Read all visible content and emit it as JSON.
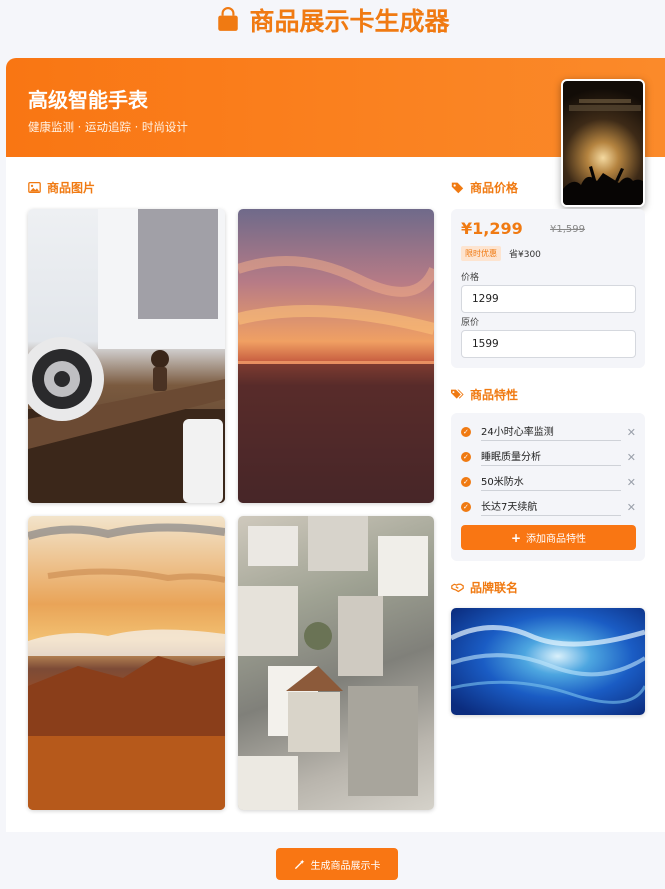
{
  "header": {
    "title": "商品展示卡生成器",
    "icon": "shopping-bag-icon"
  },
  "banner": {
    "title": "高级智能手表",
    "subtitle": "健康监测 · 运动追踪 · 时尚设计"
  },
  "images_section": {
    "heading": "商品图片",
    "icon": "image-icon"
  },
  "price_section": {
    "heading": "商品价格",
    "icon": "tag-icon",
    "current": "¥1,299",
    "original": "¥1,599",
    "promo_badge": "限时优惠",
    "save_text": "省¥300",
    "price_label": "价格",
    "price_value": "1299",
    "original_label": "原价",
    "original_value": "1599"
  },
  "features_section": {
    "heading": "商品特性",
    "icon": "tags-icon",
    "items": [
      {
        "label": "24小时心率监测"
      },
      {
        "label": "睡眠质量分析"
      },
      {
        "label": "50米防水"
      },
      {
        "label": "长达7天续航"
      }
    ],
    "add_label": "添加商品特性"
  },
  "brand_section": {
    "heading": "品牌联名",
    "icon": "handshake-icon"
  },
  "generate_button": {
    "label": "生成商品展示卡",
    "icon": "magic-wand-icon"
  },
  "colors": {
    "accent": "#f97613",
    "accent_text": "#f07a12",
    "panel": "#f4f5f9"
  }
}
